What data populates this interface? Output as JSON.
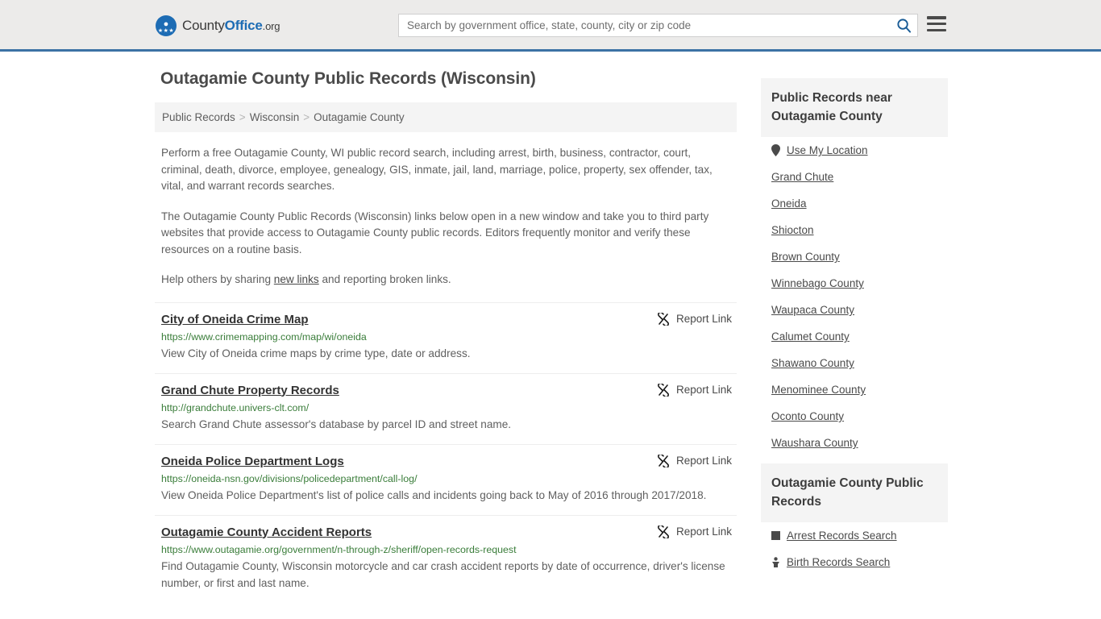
{
  "header": {
    "logo": {
      "part1": "County",
      "part2": "Office",
      "part3": ".org",
      "icon": "eagle-shield-logo"
    },
    "search": {
      "placeholder": "Search by government office, state, county, city or zip code",
      "value": "",
      "icon": "search-icon"
    },
    "menu": {
      "icon": "hamburger-menu-icon",
      "label": "Menu"
    }
  },
  "main": {
    "page_title": "Outagamie County Public Records (Wisconsin)",
    "breadcrumb": {
      "separator": ">",
      "items": [
        {
          "label": "Public Records"
        },
        {
          "label": "Wisconsin"
        },
        {
          "label": "Outagamie County"
        }
      ]
    },
    "intro": {
      "paragraph1": "Perform a free Outagamie County, WI public record search, including arrest, birth, business, contractor, court, criminal, death, divorce, employee, genealogy, GIS, inmate, jail, land, marriage, police, property, sex offender, tax, vital, and warrant records searches.",
      "paragraph2": "The Outagamie County Public Records (Wisconsin) links below open in a new window and take you to third party websites that provide access to Outagamie County public records. Editors frequently monitor and verify these resources on a routine basis.",
      "help_prefix": "Help others by sharing ",
      "help_link": "new links",
      "help_suffix": " and reporting broken links."
    },
    "report_link_label": "Report Link",
    "report_link_icon": "broken-chain-link-icon",
    "results": [
      {
        "title": "City of Oneida Crime Map",
        "url": "https://www.crimemapping.com/map/wi/oneida",
        "description": "View City of Oneida crime maps by crime type, date or address."
      },
      {
        "title": "Grand Chute Property Records",
        "url": "http://grandchute.univers-clt.com/",
        "description": "Search Grand Chute assessor's database by parcel ID and street name."
      },
      {
        "title": "Oneida Police Department Logs",
        "url": "https://oneida-nsn.gov/divisions/policedepartment/call-log/",
        "description": "View Oneida Police Department's list of police calls and incidents going back to May of 2016 through 2017/2018."
      },
      {
        "title": "Outagamie County Accident Reports",
        "url": "https://www.outagamie.org/government/n-through-z/sheriff/open-records-request",
        "description": "Find Outagamie County, Wisconsin motorcycle and car crash accident reports by date of occurrence, driver's license number, or first and last name."
      }
    ]
  },
  "sidebar": {
    "nearby": {
      "title": "Public Records near Outagamie County",
      "items": [
        {
          "label": "Use My Location",
          "icon": "map-pin-icon"
        },
        {
          "label": "Grand Chute",
          "icon": ""
        },
        {
          "label": "Oneida",
          "icon": ""
        },
        {
          "label": "Shiocton",
          "icon": ""
        },
        {
          "label": "Brown County",
          "icon": ""
        },
        {
          "label": "Winnebago County",
          "icon": ""
        },
        {
          "label": "Waupaca County",
          "icon": ""
        },
        {
          "label": "Calumet County",
          "icon": ""
        },
        {
          "label": "Shawano County",
          "icon": ""
        },
        {
          "label": "Menominee County",
          "icon": ""
        },
        {
          "label": "Oconto County",
          "icon": ""
        },
        {
          "label": "Waushara County",
          "icon": ""
        }
      ]
    },
    "county_records": {
      "title": "Outagamie County Public Records",
      "items": [
        {
          "label": "Arrest Records Search",
          "icon": "arrest-record-icon"
        },
        {
          "label": "Birth Records Search",
          "icon": "birth-record-icon"
        }
      ]
    }
  },
  "colors": {
    "header_bg": "#ecebea",
    "header_border": "#3c72a4",
    "brand_blue": "#1d6cb4",
    "url_green": "#3a7d3a",
    "panel_gray": "#f4f4f4",
    "text_gray": "#5f5f5f"
  }
}
